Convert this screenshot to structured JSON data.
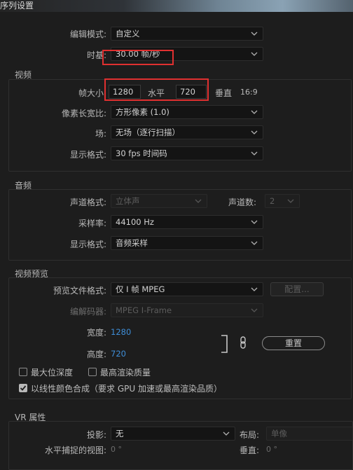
{
  "window": {
    "title": "序列设置"
  },
  "general": {
    "edit_mode_label": "编辑模式:",
    "edit_mode_value": "自定义",
    "timebase_label": "时基:",
    "timebase_value": "30.00 帧/秒"
  },
  "video": {
    "section_title": "视频",
    "frame_size_label": "帧大小",
    "width_value": "1280",
    "horizontal_label": "水平",
    "height_value": "720",
    "vertical_label": "垂直",
    "aspect": "16:9",
    "pixel_aspect_label": "像素长宽比:",
    "pixel_aspect_value": "方形像素 (1.0)",
    "field_label": "场:",
    "field_value": "无场（逐行扫描）",
    "display_format_label": "显示格式:",
    "display_format_value": "30 fps 时间码"
  },
  "audio": {
    "section_title": "音频",
    "channel_format_label": "声道格式:",
    "channel_format_value": "立体声",
    "channel_count_label": "声道数:",
    "channel_count_value": "2",
    "sample_rate_label": "采样率:",
    "sample_rate_value": "44100 Hz",
    "display_format_label": "显示格式:",
    "display_format_value": "音频采样"
  },
  "preview": {
    "section_title": "视频预览",
    "file_format_label": "预览文件格式:",
    "file_format_value": "仅 I 帧 MPEG",
    "config_button": "配置...",
    "codec_label": "编解码器:",
    "codec_value": "MPEG I-Frame",
    "width_label": "宽度:",
    "width_value": "1280",
    "height_label": "高度:",
    "height_value": "720",
    "reset_button": "重置"
  },
  "options": {
    "max_bit_depth": "最大位深度",
    "max_render_quality": "最高渲染质量",
    "linear_color": "以线性颜色合成（要求 GPU 加速或最高渲染品质）"
  },
  "vr": {
    "section_title": "VR 属性",
    "projection_label": "投影:",
    "projection_value": "无",
    "layout_label": "布局:",
    "layout_value": "单像",
    "h_view_label": "水平捕捉的视图:",
    "h_view_value": "0 °",
    "v_label": "垂直:",
    "v_value": "0 °"
  },
  "colors": {
    "accent_blue": "#3f8ed8",
    "highlight_red": "#e03030",
    "background": "#1d1d1d"
  }
}
